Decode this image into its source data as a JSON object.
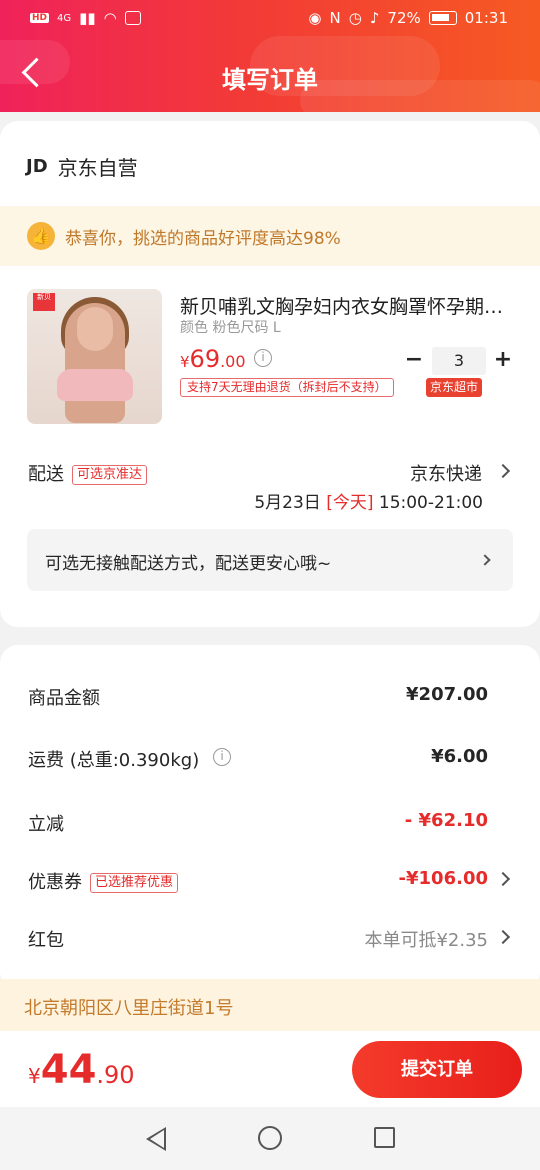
{
  "status_bar": {
    "left": [
      "HD",
      "4G"
    ],
    "battery": "72%",
    "time": "01:31"
  },
  "header": {
    "title": "填写订单"
  },
  "store": {
    "logo_text": "JD",
    "name": "京东自营"
  },
  "praise_banner": {
    "text": "恭喜你，挑选的商品好评度高达98%"
  },
  "product": {
    "image_logo": "新贝",
    "title": "新贝哺乳文胸孕妇内衣女胸罩怀孕期哺乳",
    "spec": "颜色 粉色尺码 L",
    "price_currency": "¥",
    "price_int": "69",
    "price_dec": ".00",
    "quantity": "3",
    "return_tag": "支持7天无理由退货（拆封后不支持）",
    "market_tag": "京东超市"
  },
  "shipping": {
    "label": "配送",
    "tag": "可选京准达",
    "method": "京东快递",
    "date": "5月23日 ",
    "today": "[今天]",
    "time": " 15:00-21:00",
    "contactless": "可选无接触配送方式，配送更安心哦~"
  },
  "summary": {
    "goods_amount_label": "商品金额",
    "goods_amount": "¥207.00",
    "freight_label": "运费 (总重:0.390kg)",
    "freight": "¥6.00",
    "discount_label": "立减",
    "discount": "- ¥62.10",
    "coupon_label": "优惠券",
    "coupon_tag": "已选推荐优惠",
    "coupon": "-¥106.00",
    "redpacket_label": "红包",
    "redpacket": "本单可抵¥2.35"
  },
  "address": {
    "text": "北京朝阳区八里庄街道1号"
  },
  "footer": {
    "total_currency": "¥",
    "total_int": "44",
    "total_dec": ".90",
    "submit_label": "提交订单"
  },
  "colors": {
    "accent": "#e62b2b",
    "header_start": "#f0225a",
    "header_end": "#f65a22",
    "banner_bg": "#fdf6e4"
  }
}
